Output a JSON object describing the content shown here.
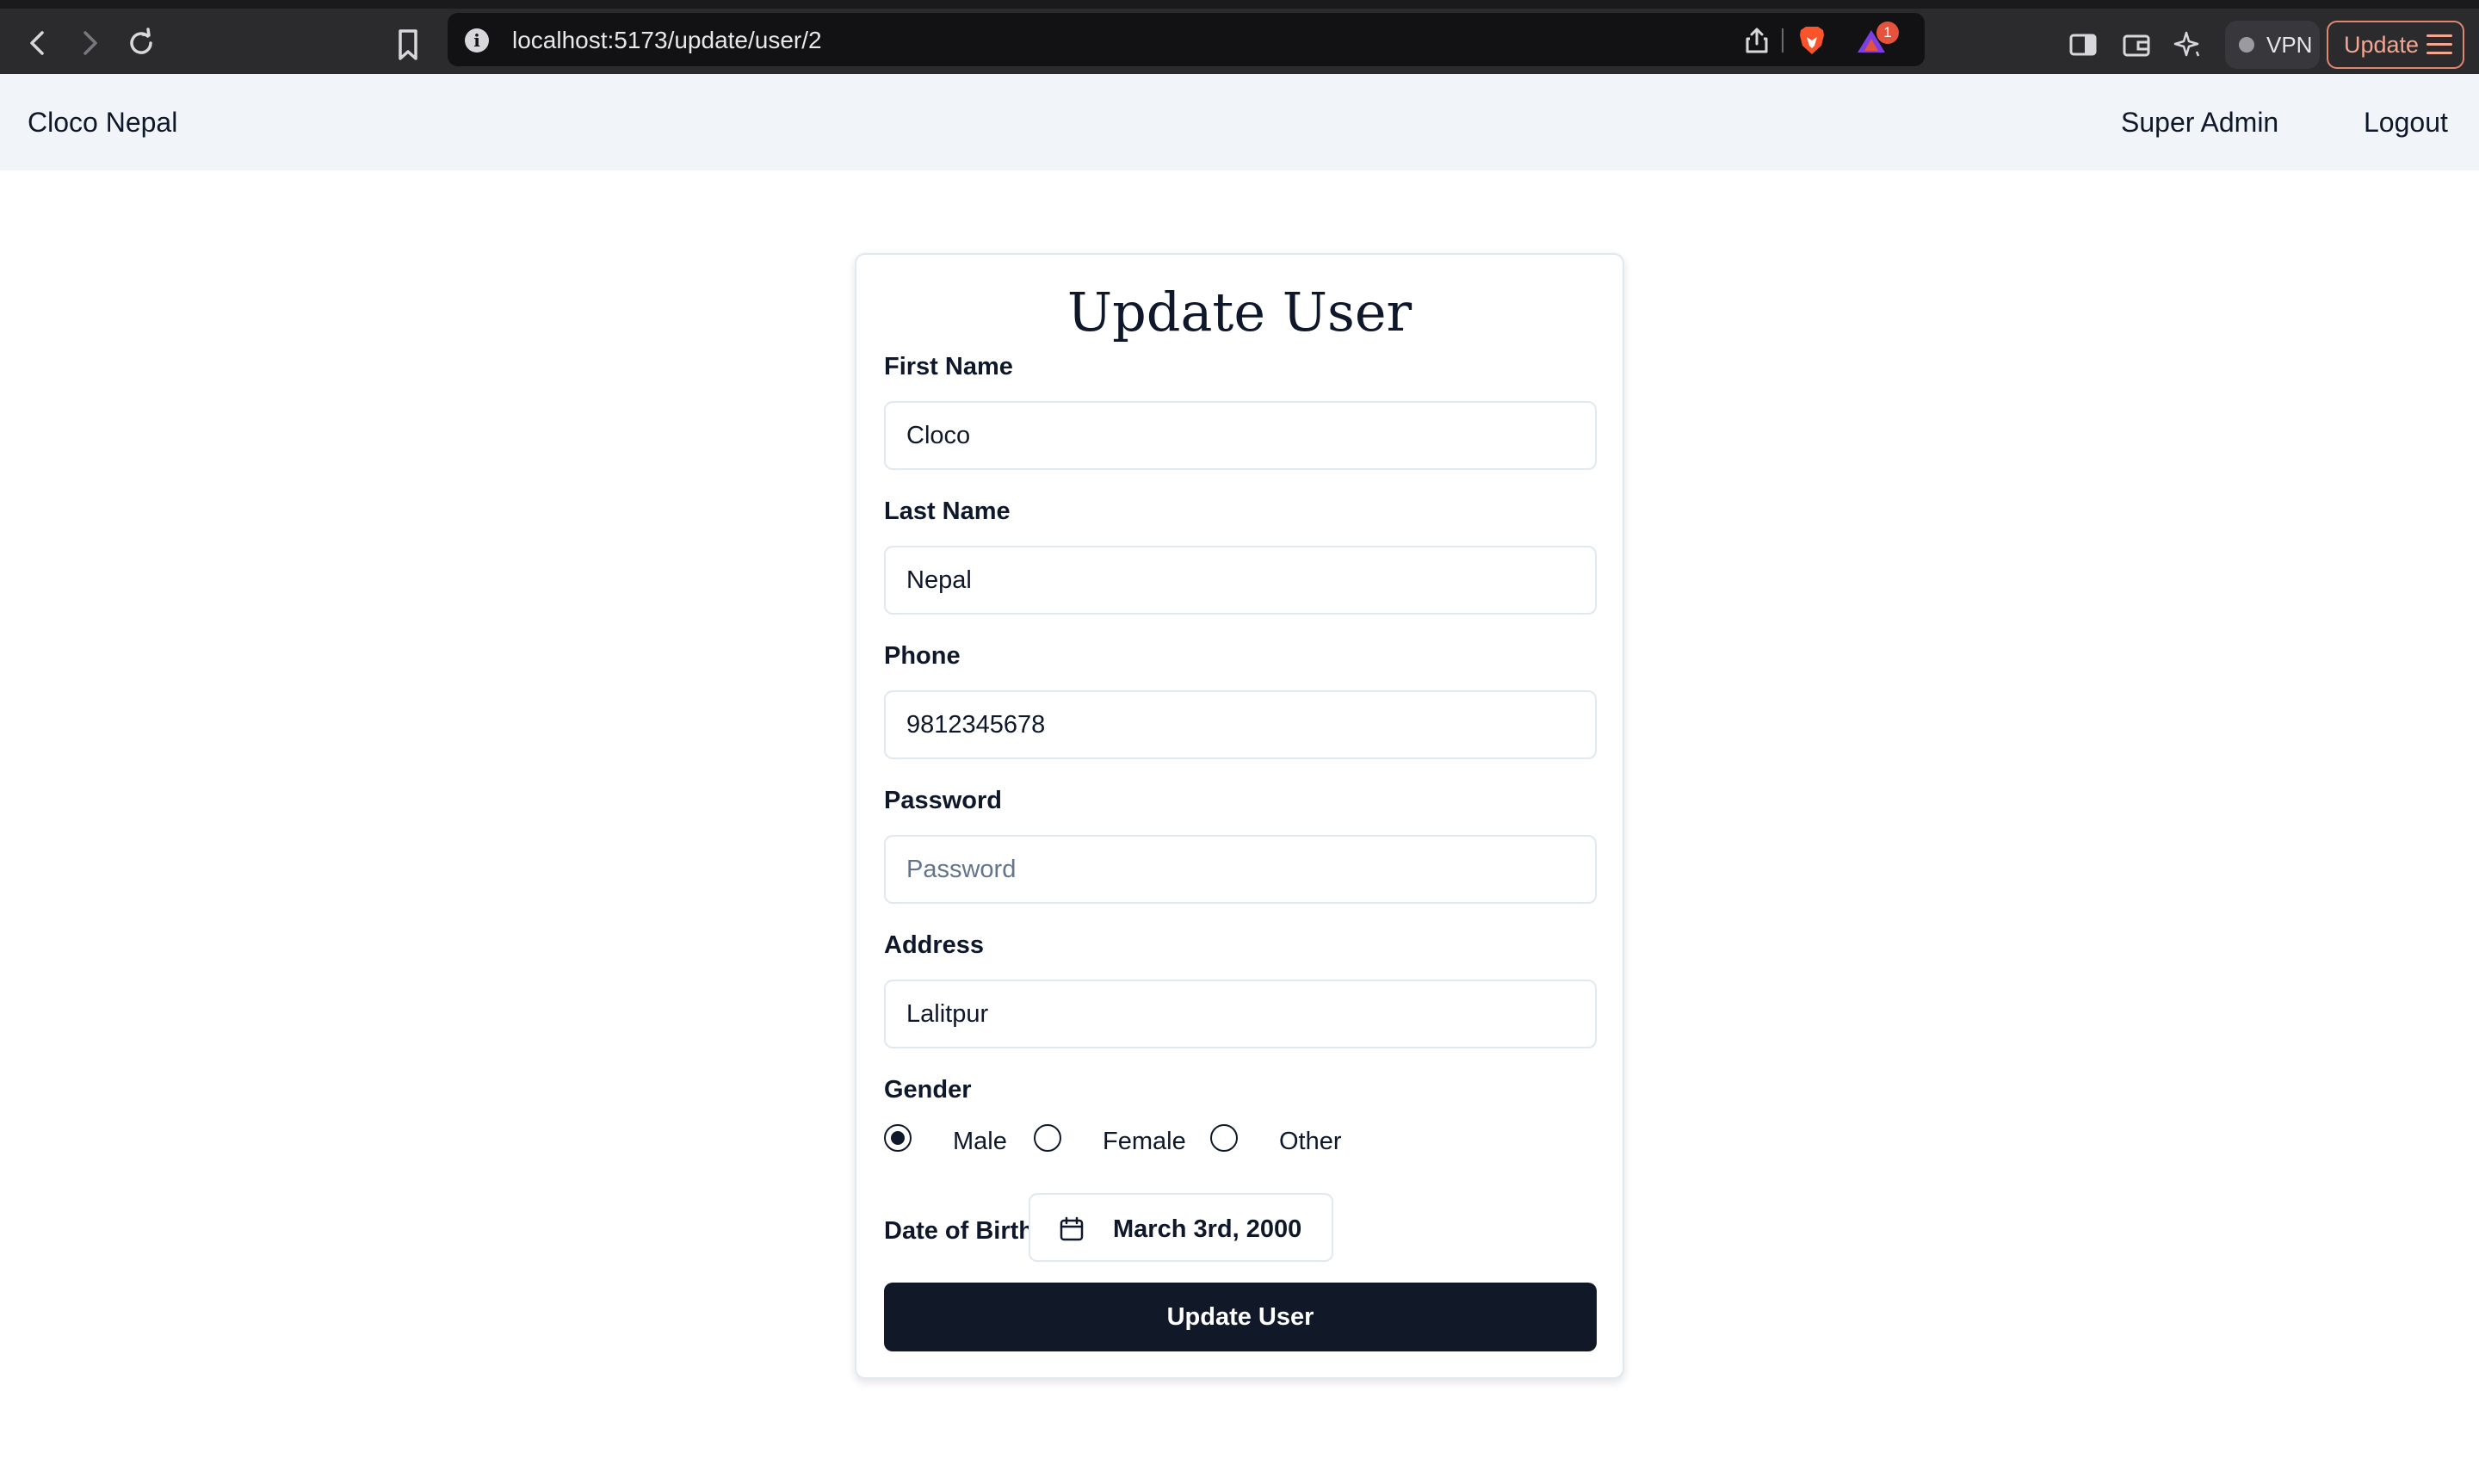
{
  "browser": {
    "url": "localhost:5173/update/user/2",
    "rewards_badge": "1",
    "vpn_label": "VPN",
    "update_label": "Update"
  },
  "header": {
    "brand": "Cloco Nepal",
    "user_role": "Super Admin",
    "logout_label": "Logout"
  },
  "form": {
    "title": "Update User",
    "first_name": {
      "label": "First Name",
      "value": "Cloco"
    },
    "last_name": {
      "label": "Last Name",
      "value": "Nepal"
    },
    "phone": {
      "label": "Phone",
      "value": "9812345678"
    },
    "password": {
      "label": "Password",
      "value": "",
      "placeholder": "Password"
    },
    "address": {
      "label": "Address",
      "value": "Lalitpur"
    },
    "gender": {
      "label": "Gender",
      "options": [
        "Male",
        "Female",
        "Other"
      ],
      "selected": "Male"
    },
    "dob": {
      "label": "Date of Birth",
      "value": "March 3rd, 2000"
    },
    "submit_label": "Update User"
  }
}
